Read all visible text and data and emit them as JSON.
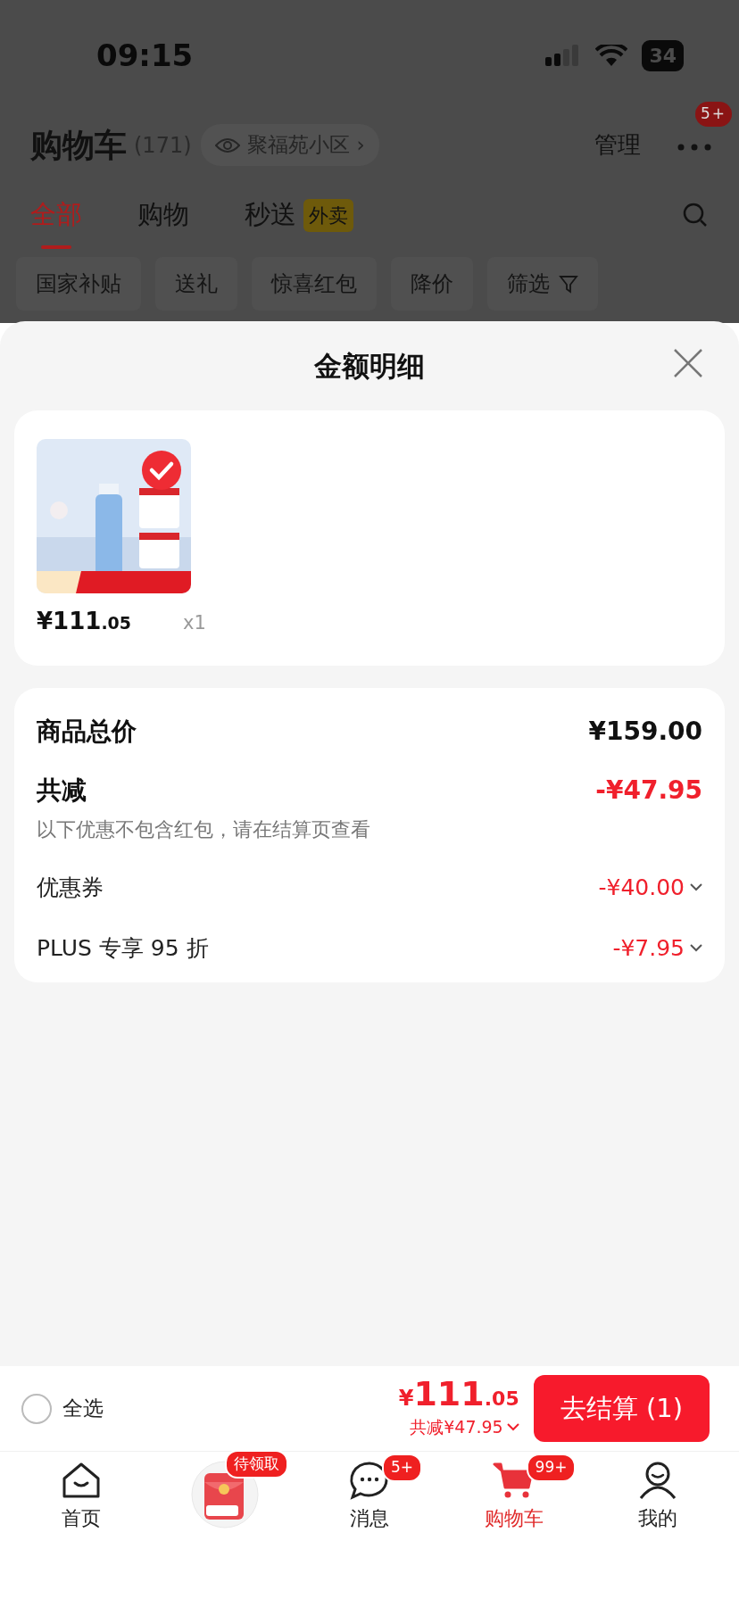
{
  "status_bar": {
    "time": "09:15",
    "battery": "34"
  },
  "header": {
    "title": "购物车",
    "count": "(171)",
    "location": "聚福苑小区",
    "chevron": "›",
    "manage": "管理",
    "more_badge": "5+"
  },
  "tabs": [
    {
      "label": "全部",
      "selected": true
    },
    {
      "label": "购物",
      "selected": false
    },
    {
      "label": "秒送",
      "selected": false,
      "tag": "外卖"
    }
  ],
  "filters": [
    {
      "label": "国家补贴",
      "kind": "chip"
    },
    {
      "label": "送礼",
      "kind": "chip"
    },
    {
      "label": "惊喜红包",
      "kind": "chip"
    },
    {
      "label": "降价",
      "kind": "chip"
    },
    {
      "label": "筛选",
      "kind": "filter"
    }
  ],
  "sheet": {
    "title": "金额明细",
    "items": [
      {
        "kind": "picture",
        "selected": true,
        "price_main": "¥111",
        "price_cents": ".05",
        "quantity": "x1"
      }
    ],
    "summary": {
      "total_label": "商品总价",
      "total_value": "¥159.00",
      "discount_label": "共减",
      "discount_value": "-¥47.95",
      "note": "以下优惠不包含红包，请在结算页查看",
      "details": [
        {
          "label": "优惠券",
          "value": "-¥40.00"
        },
        {
          "label": "PLUS 专享 95 折",
          "value": "-¥7.95"
        }
      ]
    }
  },
  "checkout": {
    "select_all": {
      "label": "全选",
      "checked": false
    },
    "currency": "¥",
    "price_main": "111",
    "price_cents": ".05",
    "discount": "共减¥47.95",
    "button": "去结算 (1)"
  },
  "nav": [
    {
      "kind": "home",
      "label": "首页",
      "selected": false
    },
    {
      "kind": "red_packet",
      "badge": "待领取",
      "selected": false
    },
    {
      "kind": "message",
      "label": "消息",
      "badge": "5+",
      "selected": false
    },
    {
      "kind": "cart",
      "label": "购物车",
      "badge": "99+",
      "selected": true
    },
    {
      "kind": "profile",
      "label": "我的",
      "selected": false
    }
  ]
}
